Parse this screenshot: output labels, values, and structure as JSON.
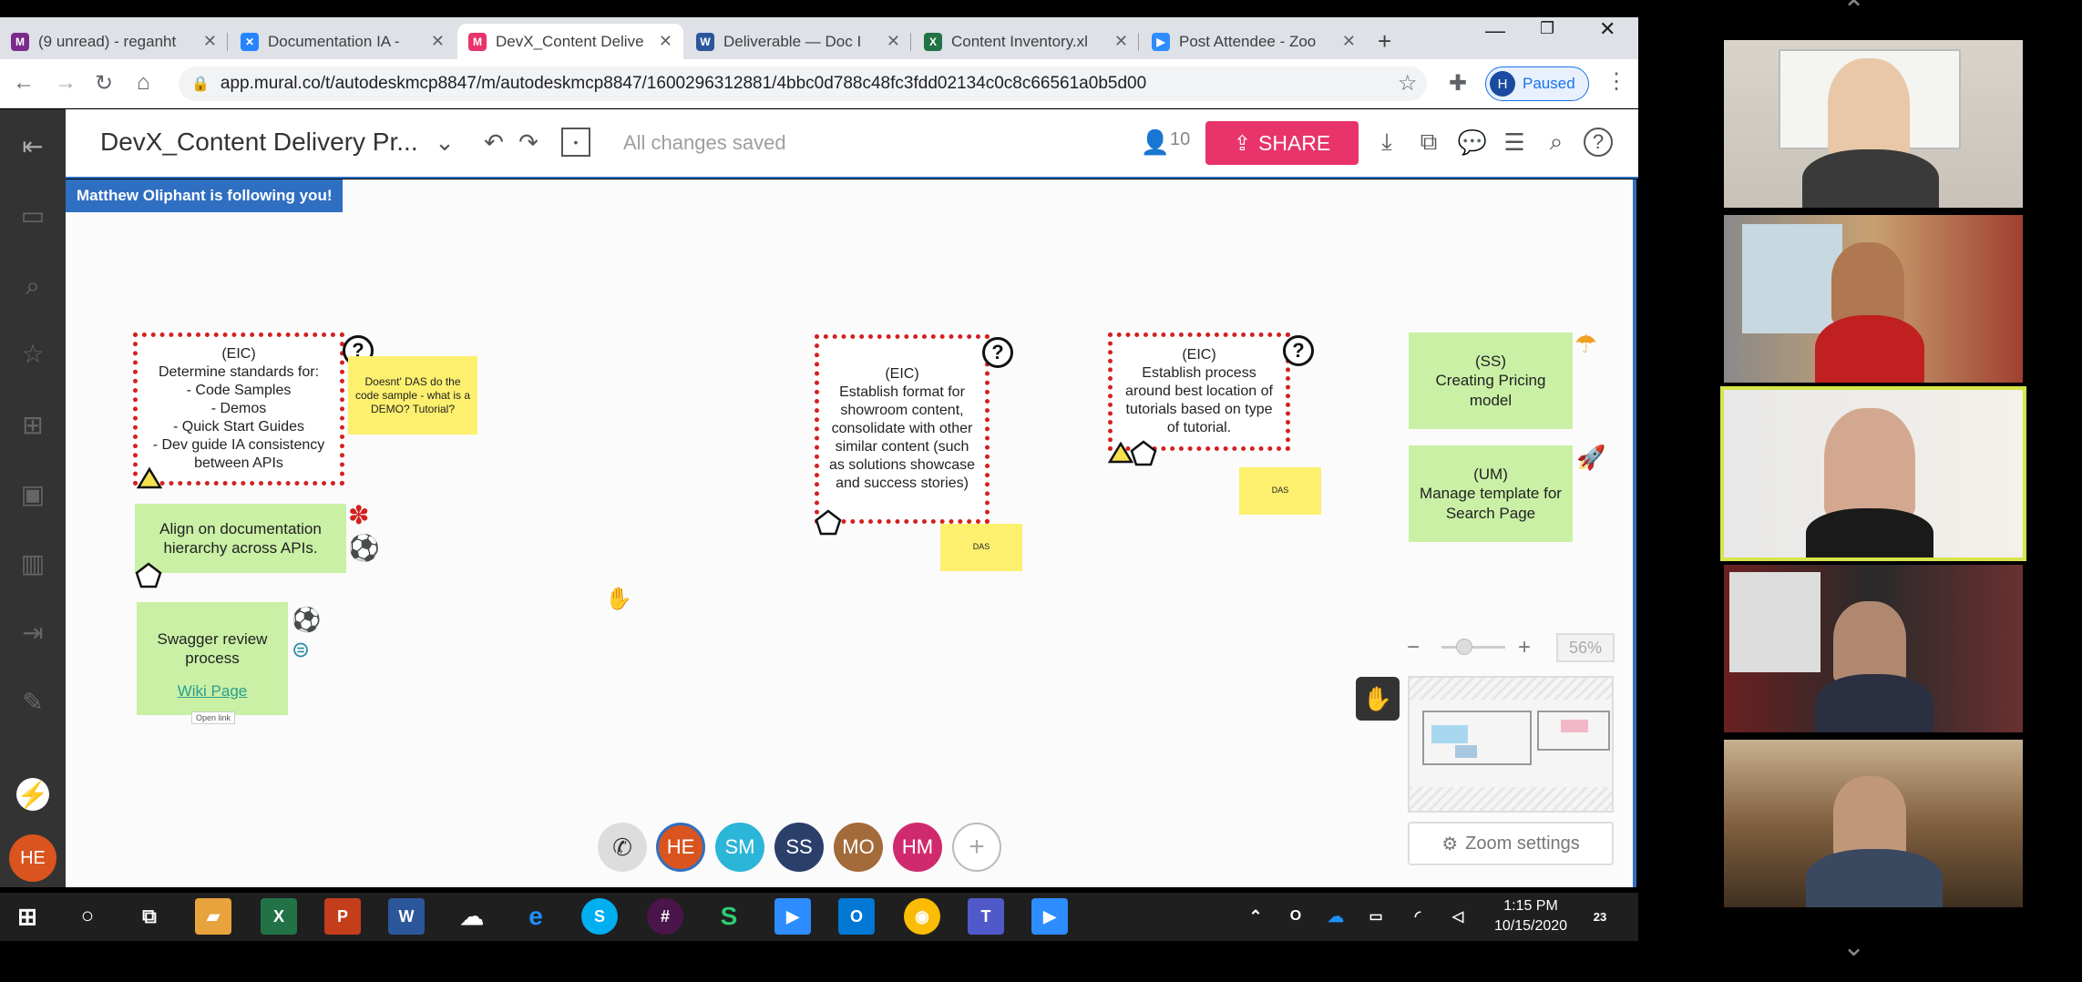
{
  "browser": {
    "tabs": [
      {
        "label": "(9 unread) - reganht",
        "icon": "mail-icon",
        "color": "#7b2a8c"
      },
      {
        "label": "Documentation IA - ",
        "icon": "confluence-icon",
        "color": "#2684ff"
      },
      {
        "label": "DevX_Content Delive",
        "icon": "mural-icon",
        "color": "#e8336b",
        "active": true
      },
      {
        "label": "Deliverable — Doc I",
        "icon": "word-icon",
        "color": "#2b579a"
      },
      {
        "label": "Content Inventory.xl",
        "icon": "excel-icon",
        "color": "#217346"
      },
      {
        "label": "Post Attendee - Zoo",
        "icon": "zoom-icon",
        "color": "#2d8cff"
      }
    ],
    "new_tab": "+",
    "url": "app.mural.co/t/autodeskmcp8847/m/autodeskmcp8847/1600296312881/4bbc0d788c48fc3fdd02134c0c8c66561a0b5d00",
    "profile_initial": "H",
    "profile_status": "Paused"
  },
  "mural": {
    "board_title": "DevX_Content Delivery Pr...",
    "save_status": "All changes saved",
    "user_count": "10",
    "share_label": "SHARE",
    "follow_banner": "Matthew Oliphant is following you!",
    "zoom_level": "56%",
    "zoom_settings": "Zoom settings",
    "user_initial": "HE"
  },
  "stickies": {
    "eic1": "(EIC)\nDetermine standards for:\n- Code Samples\n- Demos\n- Quick Start Guides\n- Dev guide IA consistency between APIs",
    "eic1_note": "Doesnt' DAS do the code sample - what is a DEMO? Tutorial?",
    "align": "Align on documentation hierarchy across APIs.",
    "swagger": "Swagger review process",
    "wiki": "Wiki Page",
    "open_link": "Open link",
    "eic2": "(EIC)\nEstablish format for showroom content, consolidate with other similar content (such as solutions showcase and success stories)",
    "das1": "DAS",
    "eic3": "(EIC)\nEstablish process around best location of tutorials based on type of tutorial.",
    "das2": "DAS",
    "ss": "(SS)\nCreating Pricing model",
    "um": "(UM)\nManage template for Search Page",
    "qmark": "?"
  },
  "collaborators": [
    {
      "initials": "HE",
      "color": "#d9541e"
    },
    {
      "initials": "SM",
      "color": "#2bb5d8"
    },
    {
      "initials": "SS",
      "color": "#2b3f6b"
    },
    {
      "initials": "MO",
      "color": "#a36a3a"
    },
    {
      "initials": "HM",
      "color": "#d02a6e"
    }
  ],
  "taskbar": {
    "time": "1:15 PM",
    "date": "10/15/2020",
    "notifications": "23"
  }
}
